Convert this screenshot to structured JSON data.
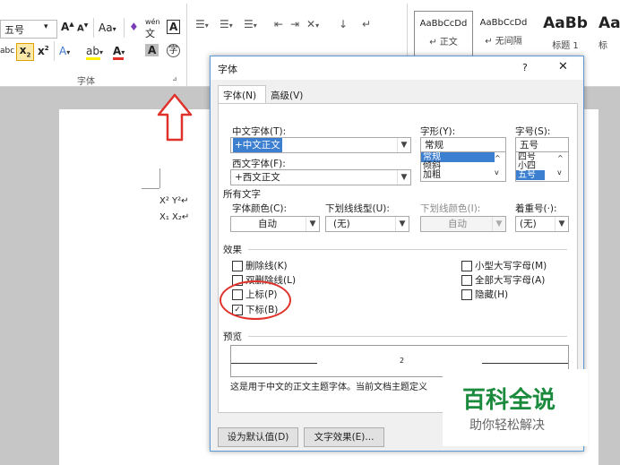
{
  "ribbon": {
    "font_size_value": "五号",
    "font_group_label": "字体",
    "grow_font": "A",
    "shrink_font": "A",
    "change_case": "Aa",
    "phonetic": "wén",
    "char_border": "A",
    "styles": [
      {
        "preview": "AaBbCcDd",
        "name": "↵ 正文"
      },
      {
        "preview": "AaBbCcDd",
        "name": "↵ 无间隔"
      },
      {
        "preview": "AaBb",
        "name": "标题 1"
      },
      {
        "preview": "Aa",
        "name": "标"
      }
    ]
  },
  "document": {
    "line1": "X² Y²↵",
    "line2": "X₁ X₂↵"
  },
  "dialog": {
    "title": "字体",
    "help": "?",
    "close": "✕",
    "tabs": [
      "字体(N)",
      "高级(V)"
    ],
    "cn_font_label": "中文字体(T):",
    "cn_font_value": "+中文正文",
    "west_font_label": "西文字体(F):",
    "west_font_value": "+西文正文",
    "style_label": "字形(Y):",
    "style_value": "常规",
    "style_options": [
      "常规",
      "倾斜",
      "加粗"
    ],
    "size_label": "字号(S):",
    "size_value": "五号",
    "size_options": [
      "四号",
      "小四",
      "五号"
    ],
    "all_text_label": "所有文字",
    "font_color_label": "字体颜色(C):",
    "font_color_value": "自动",
    "underline_label": "下划线线型(U):",
    "underline_value": "(无)",
    "underline_color_label": "下划线颜色(I):",
    "underline_color_value": "自动",
    "emphasis_label": "着重号(·):",
    "emphasis_value": "(无)",
    "effects_label": "效果",
    "effects_left": [
      {
        "label": "删除线(K)",
        "checked": false
      },
      {
        "label": "双删除线(L)",
        "checked": false
      },
      {
        "label": "上标(P)",
        "checked": false
      },
      {
        "label": "下标(B)",
        "checked": true
      }
    ],
    "effects_right": [
      {
        "label": "小型大写字母(M)",
        "checked": false
      },
      {
        "label": "全部大写字母(A)",
        "checked": false
      },
      {
        "label": "隐藏(H)",
        "checked": false
      }
    ],
    "preview_label": "预览",
    "preview_char": "2",
    "preview_note": "这是用于中文的正文主题字体。当前文档主题定义",
    "set_default_button": "设为默认值(D)",
    "text_effects_button": "文字效果(E)..."
  },
  "watermark": {
    "title": "百科全说",
    "subtitle": "助你轻松解决"
  },
  "colors": {
    "selection": "#3c7fd0",
    "annotation_red": "#e0312b",
    "watermark_green": "#1a8a3c"
  }
}
